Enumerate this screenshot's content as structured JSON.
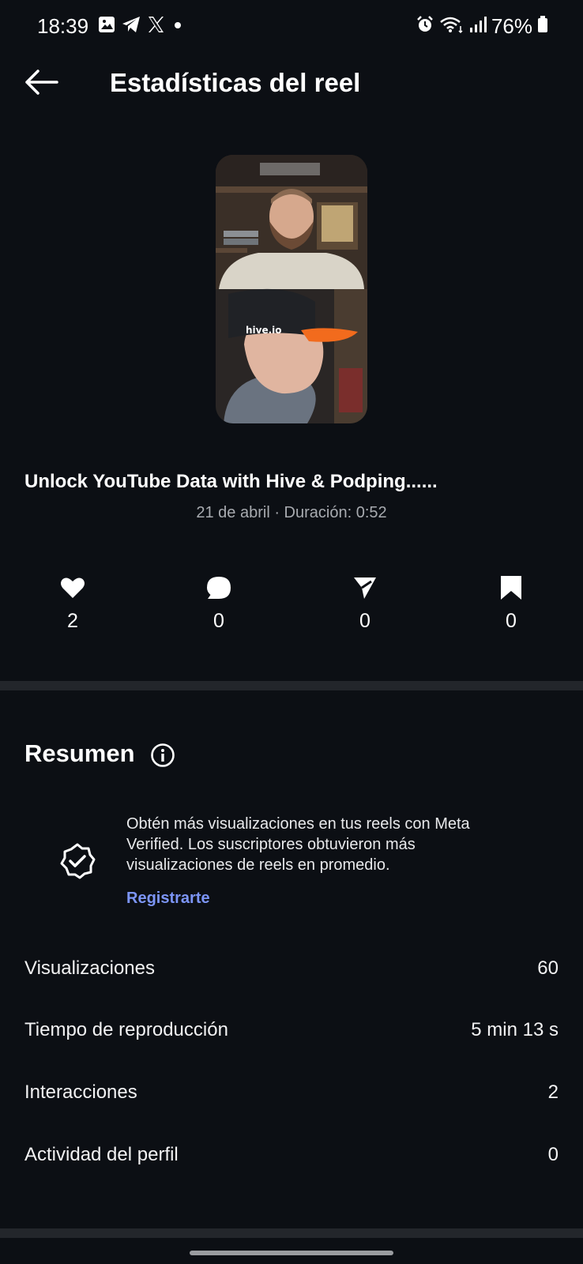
{
  "status_bar": {
    "time": "18:39",
    "battery": "76%",
    "left_icons": [
      "image-icon",
      "telegram-icon",
      "x-icon",
      "dot-icon"
    ],
    "right_icons": [
      "alarm-icon",
      "wifi-icon",
      "signal-icon",
      "battery-icon"
    ]
  },
  "header": {
    "title": "Estadísticas del reel",
    "back_icon": "arrow-left-icon"
  },
  "reel": {
    "title": "Unlock YouTube Data with Hive & Podping......",
    "meta": "21 de abril · Duración: 0:52",
    "thumbnail_overlay": "hive.io"
  },
  "engagement": [
    {
      "icon": "heart-icon",
      "value": "2"
    },
    {
      "icon": "comment-icon",
      "value": "0"
    },
    {
      "icon": "share-icon",
      "value": "0"
    },
    {
      "icon": "bookmark-icon",
      "value": "0"
    }
  ],
  "summary": {
    "title": "Resumen",
    "info_icon": "info-icon",
    "promo": {
      "text": "Obtén más visualizaciones en tus reels con Meta Verified. Los suscriptores obtuvieron más visualizaciones de reels en promedio.",
      "link": "Registrarte",
      "link_color": "#7c95f7"
    },
    "metrics": [
      {
        "label": "Visualizaciones",
        "value": "60"
      },
      {
        "label": "Tiempo de reproducción",
        "value": "5 min 13 s"
      },
      {
        "label": "Interacciones",
        "value": "2"
      },
      {
        "label": "Actividad del perfil",
        "value": "0"
      }
    ]
  },
  "colors": {
    "background": "#0c0f14",
    "divider": "#23262b",
    "muted_text": "#a8abb0"
  }
}
